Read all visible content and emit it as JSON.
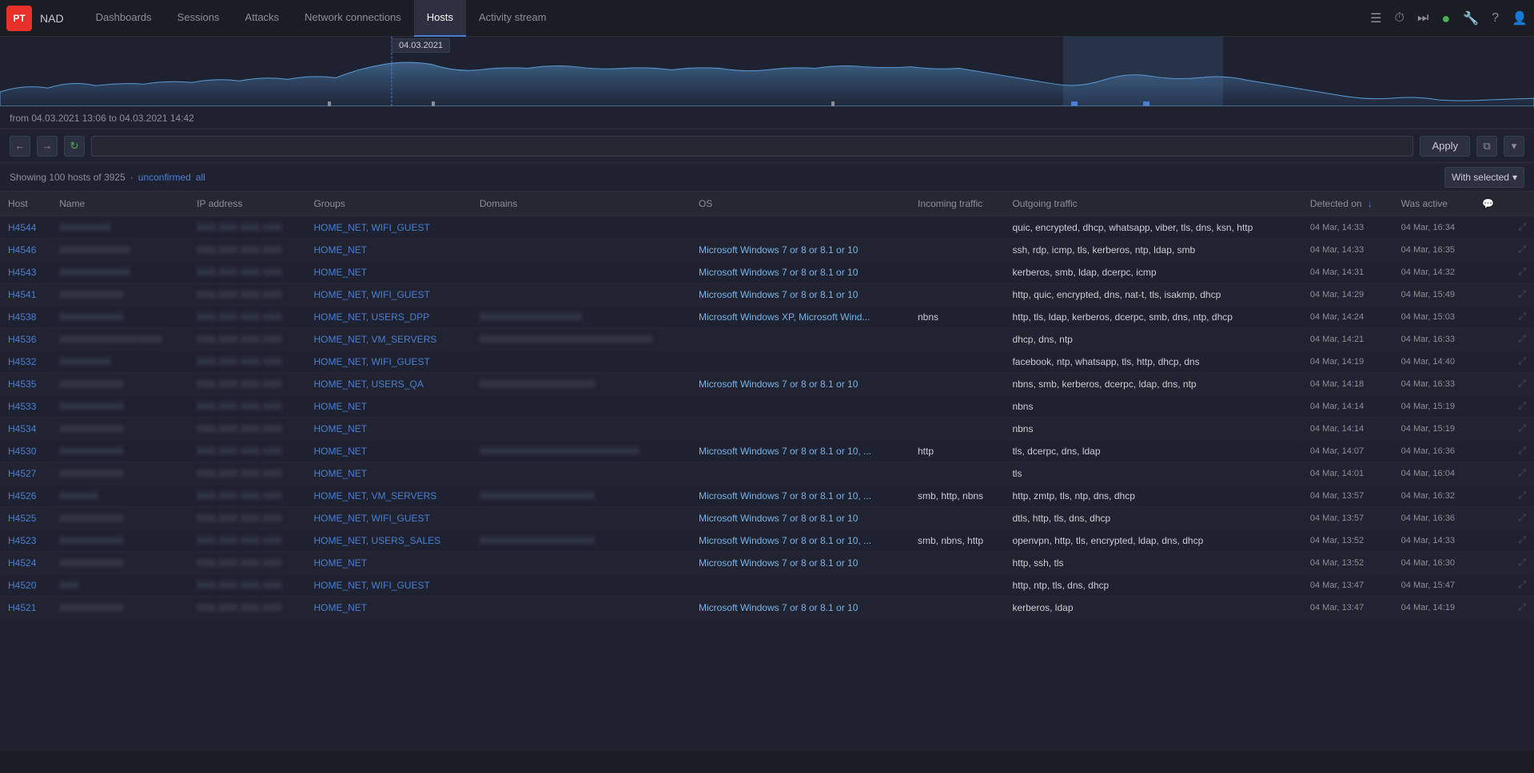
{
  "app": {
    "logo": "PT",
    "name": "NAD"
  },
  "nav": {
    "items": [
      {
        "label": "Dashboards",
        "active": false
      },
      {
        "label": "Sessions",
        "active": false
      },
      {
        "label": "Attacks",
        "active": false
      },
      {
        "label": "Network connections",
        "active": false
      },
      {
        "label": "Hosts",
        "active": true
      },
      {
        "label": "Activity stream",
        "active": false
      }
    ]
  },
  "chart": {
    "tooltip": "04.03.2021"
  },
  "timeRange": {
    "text": "from 04.03.2021 13:06 to 04.03.2021 14:42"
  },
  "filter": {
    "applyLabel": "Apply",
    "placeholder": ""
  },
  "statusBar": {
    "showing": "Showing 100 hosts of 3925",
    "separator": "·",
    "unconfirmedLabel": "unconfirmed",
    "allLabel": "all"
  },
  "withSelected": {
    "label": "With selected"
  },
  "tableHeaders": [
    {
      "label": "Host",
      "key": "host"
    },
    {
      "label": "Name",
      "key": "name"
    },
    {
      "label": "IP address",
      "key": "ip"
    },
    {
      "label": "Groups",
      "key": "groups"
    },
    {
      "label": "Domains",
      "key": "domains"
    },
    {
      "label": "OS",
      "key": "os"
    },
    {
      "label": "Incoming traffic",
      "key": "incoming"
    },
    {
      "label": "Outgoing traffic",
      "key": "outgoing"
    },
    {
      "label": "Detected on ↓",
      "key": "detected",
      "sorted": true
    },
    {
      "label": "Was active",
      "key": "active"
    },
    {
      "label": "",
      "key": "comment"
    }
  ],
  "rows": [
    {
      "host": "H4544",
      "name": "XXXXXXXX",
      "ip": "XXX.XXX.XXX.XXX",
      "groups": "HOME_NET, WIFI_GUEST",
      "domains": "",
      "os": "",
      "incoming": "",
      "outgoing": "quic, encrypted, dhcp, whatsapp, viber, tls, dns, ksn, http",
      "detected": "04 Mar, 14:33",
      "active": "04 Mar, 16:34"
    },
    {
      "host": "H4546",
      "name": "XXXXXXXXXXX",
      "ip": "XXX.XXX.XXX.XXX",
      "groups": "HOME_NET",
      "domains": "",
      "os": "Microsoft Windows 7 or 8 or 8.1 or 10",
      "incoming": "",
      "outgoing": "ssh, rdp, icmp, tls, kerberos, ntp, ldap, smb",
      "detected": "04 Mar, 14:33",
      "active": "04 Mar, 16:35"
    },
    {
      "host": "H4543",
      "name": "XXXXXXXXXXX",
      "ip": "XXX.XXX.XXX.XXX",
      "groups": "HOME_NET",
      "domains": "",
      "os": "Microsoft Windows 7 or 8 or 8.1 or 10",
      "incoming": "",
      "outgoing": "kerberos, smb, ldap, dcerpc, icmp",
      "detected": "04 Mar, 14:31",
      "active": "04 Mar, 14:32"
    },
    {
      "host": "H4541",
      "name": "XXXXXXXXXX",
      "ip": "XXX.XXX.XXX.XXX",
      "groups": "HOME_NET, WIFI_GUEST",
      "domains": "",
      "os": "Microsoft Windows 7 or 8 or 8.1 or 10",
      "incoming": "",
      "outgoing": "http, quic, encrypted, dns, nat-t, tls, isakmp, dhcp",
      "detected": "04 Mar, 14:29",
      "active": "04 Mar, 15:49"
    },
    {
      "host": "H4538",
      "name": "XXXXXXXXXX",
      "ip": "XXX.XXX.XXX.XXX",
      "groups": "HOME_NET, USERS_DPP",
      "domains": "XXXXXXXXXXXXXXXX",
      "os": "Microsoft Windows XP, Microsoft Wind...",
      "incoming": "nbns",
      "outgoing": "http, tls, ldap, kerberos, dcerpc, smb, dns, ntp, dhcp",
      "detected": "04 Mar, 14:24",
      "active": "04 Mar, 15:03"
    },
    {
      "host": "H4536",
      "name": "XXXXXXXXXXXXXXXX",
      "ip": "XXX.XXX.XXX.XXX",
      "groups": "HOME_NET, VM_SERVERS",
      "domains": "XXXXXXXXXXXXXXXXXXXXXXXXXXX",
      "os": "",
      "incoming": "",
      "outgoing": "dhcp, dns, ntp",
      "detected": "04 Mar, 14:21",
      "active": "04 Mar, 16:33"
    },
    {
      "host": "H4532",
      "name": "XXXXXXXX",
      "ip": "XXX.XXX.XXX.XXX",
      "groups": "HOME_NET, WIFI_GUEST",
      "domains": "",
      "os": "",
      "incoming": "",
      "outgoing": "facebook, ntp, whatsapp, tls, http, dhcp, dns",
      "detected": "04 Mar, 14:19",
      "active": "04 Mar, 14:40"
    },
    {
      "host": "H4535",
      "name": "XXXXXXXXXX",
      "ip": "XXX.XXX.XXX.XXX",
      "groups": "HOME_NET, USERS_QA",
      "domains": "XXXXXXXXXXXXXXXXXX",
      "os": "Microsoft Windows 7 or 8 or 8.1 or 10",
      "incoming": "",
      "outgoing": "nbns, smb, kerberos, dcerpc, ldap, dns, ntp",
      "detected": "04 Mar, 14:18",
      "active": "04 Mar, 16:33"
    },
    {
      "host": "H4533",
      "name": "XXXXXXXXXX",
      "ip": "XXX.XXX.XXX.XXX",
      "groups": "HOME_NET",
      "domains": "",
      "os": "",
      "incoming": "",
      "outgoing": "nbns",
      "detected": "04 Mar, 14:14",
      "active": "04 Mar, 15:19"
    },
    {
      "host": "H4534",
      "name": "XXXXXXXXXX",
      "ip": "XXX.XXX.XXX.XXX",
      "groups": "HOME_NET",
      "domains": "",
      "os": "",
      "incoming": "",
      "outgoing": "nbns",
      "detected": "04 Mar, 14:14",
      "active": "04 Mar, 15:19"
    },
    {
      "host": "H4530",
      "name": "XXXXXXXXXX",
      "ip": "XXX.XXX.XXX.XXX",
      "groups": "HOME_NET",
      "domains": "XXXXXXXXXXXXXXXXXXXXXXXXX",
      "os": "Microsoft Windows 7 or 8 or 8.1 or 10, ...",
      "incoming": "http",
      "outgoing": "tls, dcerpc, dns, ldap",
      "detected": "04 Mar, 14:07",
      "active": "04 Mar, 16:36"
    },
    {
      "host": "H4527",
      "name": "XXXXXXXXXX",
      "ip": "XXX.XXX.XXX.XXX",
      "groups": "HOME_NET",
      "domains": "",
      "os": "",
      "incoming": "",
      "outgoing": "tls",
      "detected": "04 Mar, 14:01",
      "active": "04 Mar, 16:04"
    },
    {
      "host": "H4526",
      "name": "XXXXXX",
      "ip": "XXX.XXX.XXX.XXX",
      "groups": "HOME_NET, VM_SERVERS",
      "domains": "XXXXXXXXXXXXXXXXXX",
      "os": "Microsoft Windows 7 or 8 or 8.1 or 10, ...",
      "incoming": "smb, http, nbns",
      "outgoing": "http, zmtp, tls, ntp, dns, dhcp",
      "detected": "04 Mar, 13:57",
      "active": "04 Mar, 16:32"
    },
    {
      "host": "H4525",
      "name": "XXXXXXXXXX",
      "ip": "XXX.XXX.XXX.XXX",
      "groups": "HOME_NET, WIFI_GUEST",
      "domains": "",
      "os": "Microsoft Windows 7 or 8 or 8.1 or 10",
      "incoming": "",
      "outgoing": "dtls, http, tls, dns, dhcp",
      "detected": "04 Mar, 13:57",
      "active": "04 Mar, 16:36"
    },
    {
      "host": "H4523",
      "name": "XXXXXXXXXX",
      "ip": "XXX.XXX.XXX.XXX",
      "groups": "HOME_NET, USERS_SALES",
      "domains": "XXXXXXXXXXXXXXXXXX",
      "os": "Microsoft Windows 7 or 8 or 8.1 or 10, ...",
      "incoming": "smb, nbns, http",
      "outgoing": "openvpn, http, tls, encrypted, ldap, dns, dhcp",
      "detected": "04 Mar, 13:52",
      "active": "04 Mar, 14:33"
    },
    {
      "host": "H4524",
      "name": "XXXXXXXXXX",
      "ip": "XXX.XXX.XXX.XXX",
      "groups": "HOME_NET",
      "domains": "",
      "os": "Microsoft Windows 7 or 8 or 8.1 or 10",
      "incoming": "",
      "outgoing": "http, ssh, tls",
      "detected": "04 Mar, 13:52",
      "active": "04 Mar, 16:30"
    },
    {
      "host": "H4520",
      "name": "XXX",
      "ip": "XXX.XXX.XXX.XXX",
      "groups": "HOME_NET, WIFI_GUEST",
      "domains": "",
      "os": "",
      "incoming": "",
      "outgoing": "http, ntp, tls, dns, dhcp",
      "detected": "04 Mar, 13:47",
      "active": "04 Mar, 15:47"
    },
    {
      "host": "H4521",
      "name": "XXXXXXXXXX",
      "ip": "XXX.XXX.XXX.XXX",
      "groups": "HOME_NET",
      "domains": "",
      "os": "Microsoft Windows 7 or 8 or 8.1 or 10",
      "incoming": "",
      "outgoing": "kerberos, ldap",
      "detected": "04 Mar, 13:47",
      "active": "04 Mar, 14:19"
    }
  ]
}
